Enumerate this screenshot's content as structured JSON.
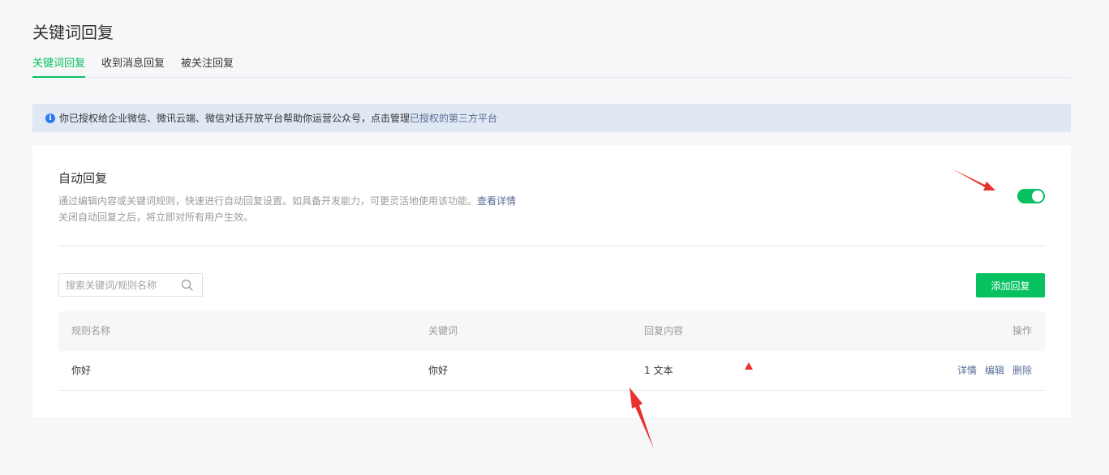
{
  "page": {
    "title": "关键词回复"
  },
  "tabs": [
    {
      "label": "关键词回复",
      "active": true
    },
    {
      "label": "收到消息回复",
      "active": false
    },
    {
      "label": "被关注回复",
      "active": false
    }
  ],
  "notice": {
    "icon": "info-icon",
    "text": "你已授权给企业微信、微讯云端、微信对话开放平台帮助你运营公众号，点击管理",
    "link": "已授权的第三方平台"
  },
  "auto_reply": {
    "title": "自动回复",
    "desc_line1": "通过编辑内容或关键词规则，快速进行自动回复设置。如具备开发能力，可更灵活地使用该功能。",
    "detail_link": "查看详情",
    "desc_line2": "关闭自动回复之后，将立即对所有用户生效。",
    "enabled": true
  },
  "search": {
    "placeholder": "搜索关键词/规则名称",
    "value": "",
    "icon": "search-icon"
  },
  "add_button": {
    "label": "添加回复"
  },
  "table": {
    "headers": {
      "name": "规则名称",
      "keyword": "关键词",
      "reply": "回复内容",
      "ops": "操作"
    },
    "rows": [
      {
        "name": "你好",
        "keyword": "你好",
        "reply": "1 文本",
        "ops": [
          "详情",
          "编辑",
          "删除"
        ]
      }
    ]
  },
  "colors": {
    "brand_green": "#07c160",
    "link_blue": "#576b95",
    "notice_bg": "#dfe8f3",
    "annotation_red": "#e8322f"
  }
}
